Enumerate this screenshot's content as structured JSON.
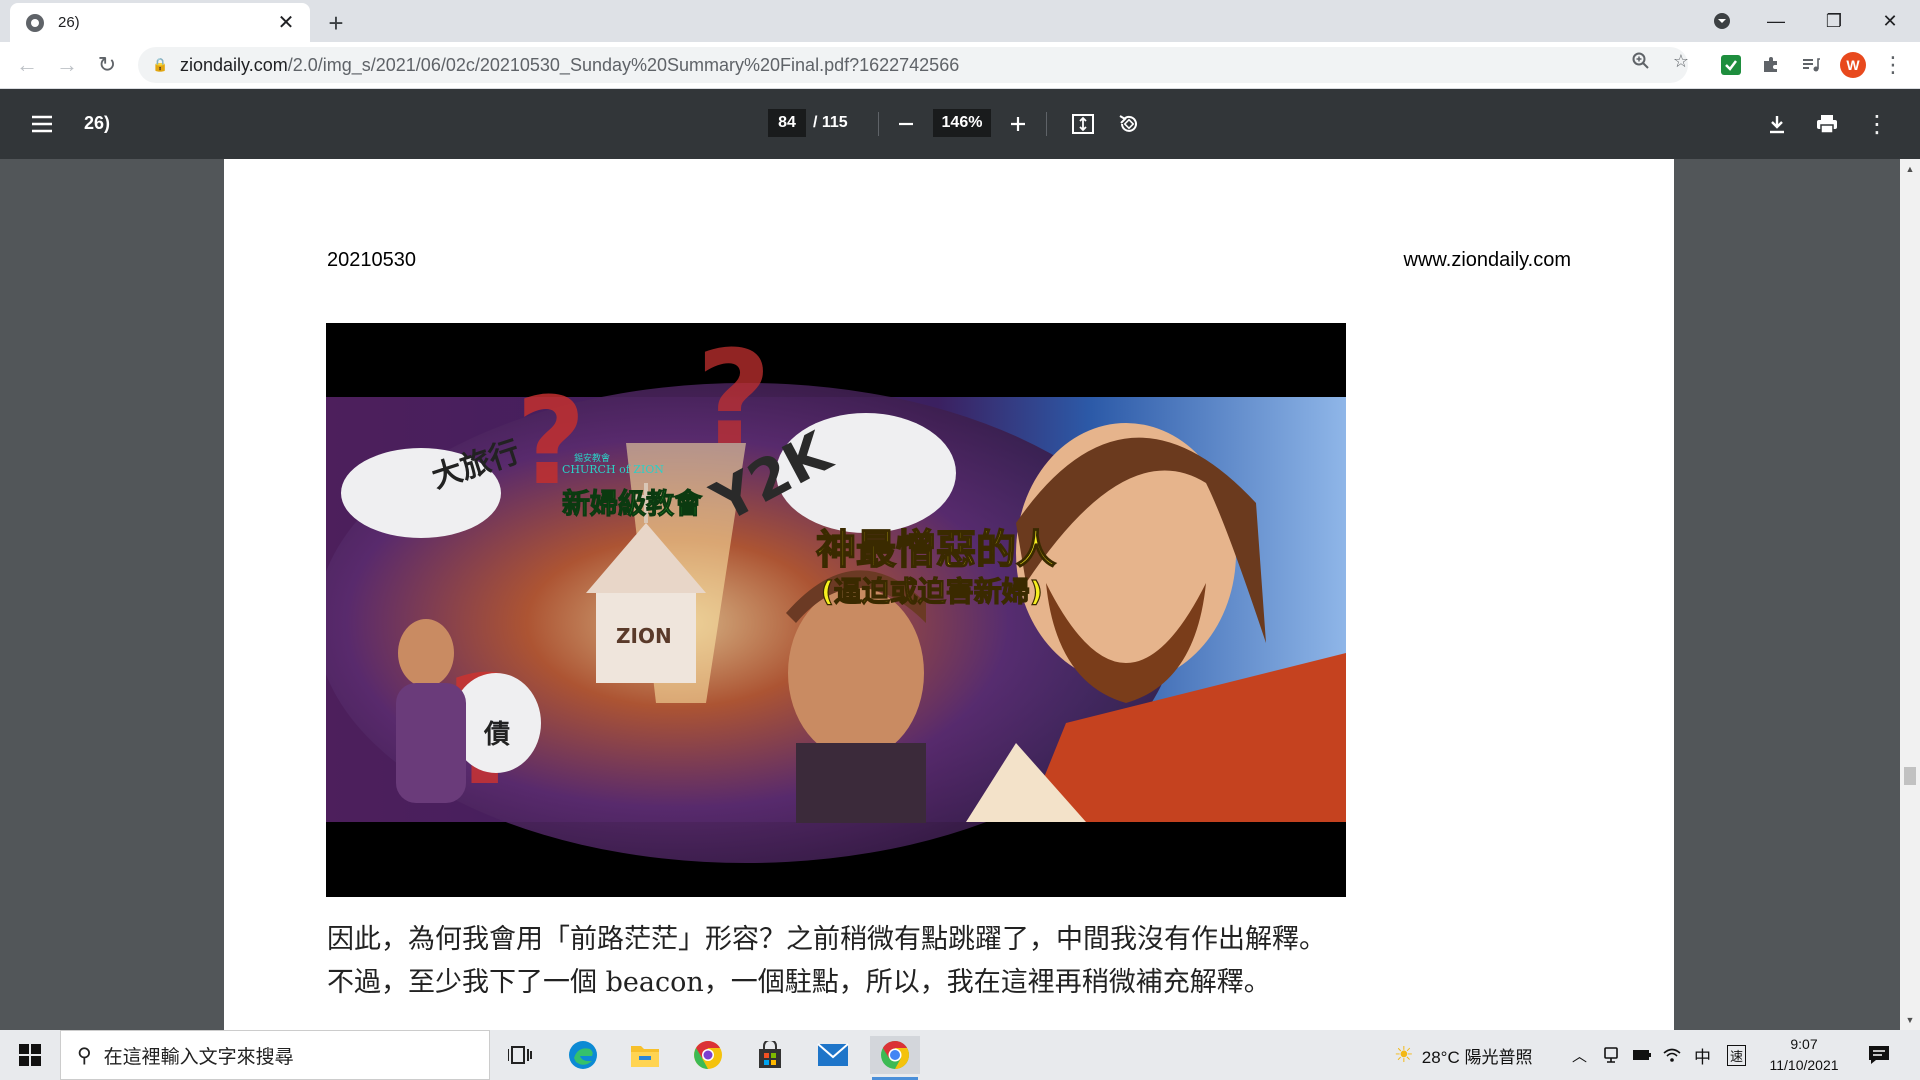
{
  "browser": {
    "tab_title": "26)",
    "url_host": "ziondaily.com",
    "url_path": "/2.0/img_s/2021/06/02c/20210530_Sunday%20Summary%20Final.pdf?1622742566",
    "profile_initial": "W"
  },
  "pdf_viewer": {
    "doc_title": "26)",
    "current_page": "84",
    "total_pages": "/ 115",
    "zoom": "146%"
  },
  "document": {
    "header_date": "20210530",
    "header_site": "www.ziondaily.com",
    "banner": {
      "church_name_small": "錫安教會",
      "church_name_en": "CHURCH of ZION",
      "group_name": "新婦級教會",
      "title_line1": "神最憎惡的人",
      "title_line2": "(逼迫或迫害新婦)",
      "y2k": "Y2K",
      "travel": "大旅行",
      "debt": "債",
      "zion": "ZION"
    },
    "body": [
      "因此，為何我會用「前路茫茫」形容？之前稍微有點跳躍了，中間我沒有作出解釋。",
      "不過，至少我下了一個 beacon，一個駐點，所以，我在這裡再稍微補充解釋。"
    ]
  },
  "taskbar": {
    "search_placeholder": "在這裡輸入文字來搜尋",
    "weather": "28°C 陽光普照",
    "ime": "中",
    "ime_mode": "速",
    "time": "9:07",
    "date": "11/10/2021"
  },
  "colors": {
    "pdf_toolbar": "#323639",
    "viewer_bg": "#525659",
    "banner_title": "#f6ef1f",
    "banner_group": "#39e23a"
  }
}
